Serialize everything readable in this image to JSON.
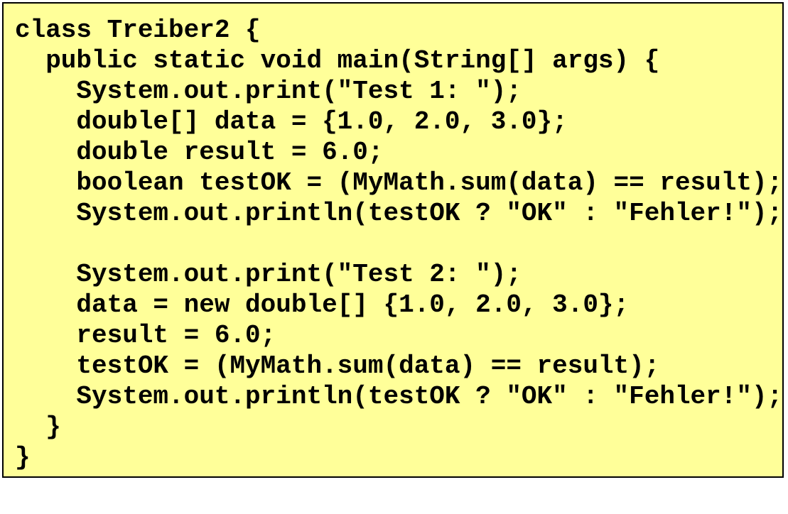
{
  "code": {
    "lines": [
      "class Treiber2 {",
      "  public static void main(String[] args) {",
      "    System.out.print(\"Test 1: \");",
      "    double[] data = {1.0, 2.0, 3.0};",
      "    double result = 6.0;",
      "    boolean testOK = (MyMath.sum(data) == result);",
      "    System.out.println(testOK ? \"OK\" : \"Fehler!\");",
      "",
      "    System.out.print(\"Test 2: \");",
      "    data = new double[] {1.0, 2.0, 3.0};",
      "    result = 6.0;",
      "    testOK = (MyMath.sum(data) == result);",
      "    System.out.println(testOK ? \"OK\" : \"Fehler!\");",
      "  }",
      "}"
    ]
  },
  "colors": {
    "background": "#ffff99",
    "border": "#000000",
    "text": "#000000"
  }
}
